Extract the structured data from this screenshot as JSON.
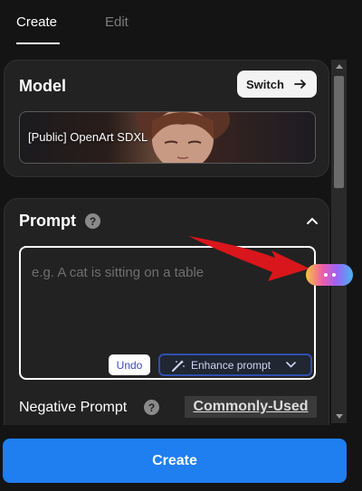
{
  "tabs": [
    {
      "label": "Create",
      "active": true
    },
    {
      "label": "Edit",
      "active": false
    }
  ],
  "model": {
    "title": "Model",
    "switch_label": "Switch",
    "selected_name": "[Public] OpenArt SDXL"
  },
  "prompt": {
    "title": "Prompt",
    "placeholder": "e.g. A cat is sitting on a table",
    "undo_label": "Undo",
    "enhance_label": "Enhance prompt"
  },
  "negative_prompt": {
    "label": "Negative Prompt",
    "preset_label": "Commonly-Used"
  },
  "create_button_label": "Create",
  "colors": {
    "accent": "#1f7ef0",
    "background": "#141414",
    "card": "#222222",
    "annotation_arrow": "#d9161b"
  }
}
